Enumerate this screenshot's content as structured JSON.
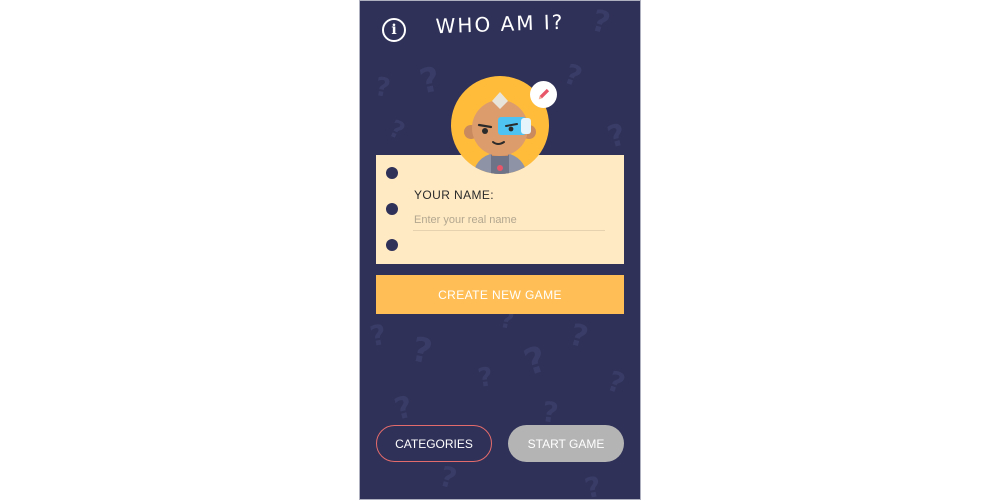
{
  "header": {
    "title": "WHO AM I?",
    "info_icon": "info-icon",
    "info_glyph": "i"
  },
  "avatar": {
    "icon": "astronaut-avatar",
    "edit_icon": "pencil-icon"
  },
  "name_form": {
    "label": "YOUR NAME:",
    "placeholder": "Enter your real name",
    "value": ""
  },
  "buttons": {
    "create_new_game": "CREATE NEW GAME",
    "categories": "CATEGORIES",
    "start_game": "START GAME"
  },
  "colors": {
    "background": "#2f3158",
    "accent": "#ffbf56",
    "card": "#ffeac4",
    "categories_border": "#e46b6b",
    "start_disabled": "#b4b4b4"
  }
}
